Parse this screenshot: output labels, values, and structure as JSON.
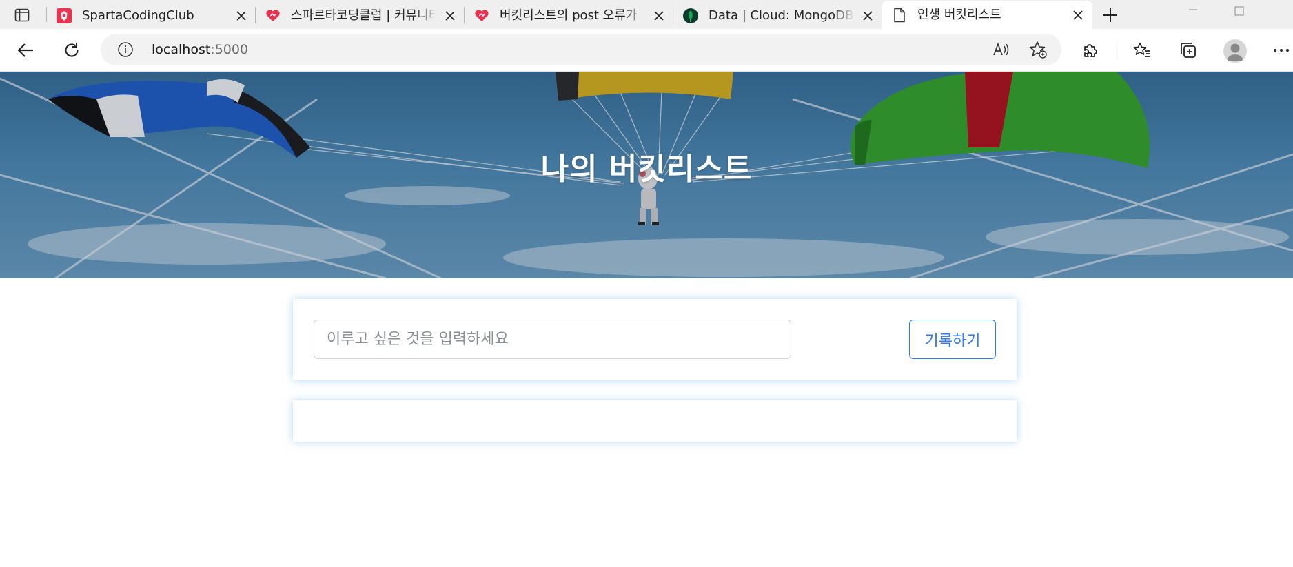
{
  "browser": {
    "tabs": [
      {
        "title": "SpartaCodingClub",
        "favicon": "sparta-icon",
        "active": false
      },
      {
        "title": "스파르타코딩클럽 | 커뮤니티",
        "favicon": "sparta-heart-icon",
        "active": false
      },
      {
        "title": "버킷리스트의 post 오류가",
        "favicon": "sparta-heart-icon",
        "active": false
      },
      {
        "title": "Data | Cloud: MongoDB Cloud",
        "favicon": "mongodb-leaf-icon",
        "active": false
      },
      {
        "title": "인생 버킷리스트",
        "favicon": "page-icon",
        "active": true
      }
    ],
    "address": {
      "host": "localhost",
      "port": ":5000"
    },
    "accent": "#2f7bf5"
  },
  "page": {
    "hero_title": "나의 버킷리스트",
    "input_placeholder": "이루고 싶은 것을 입력하세요",
    "input_value": "",
    "save_label": "기록하기",
    "bucket_items": []
  }
}
